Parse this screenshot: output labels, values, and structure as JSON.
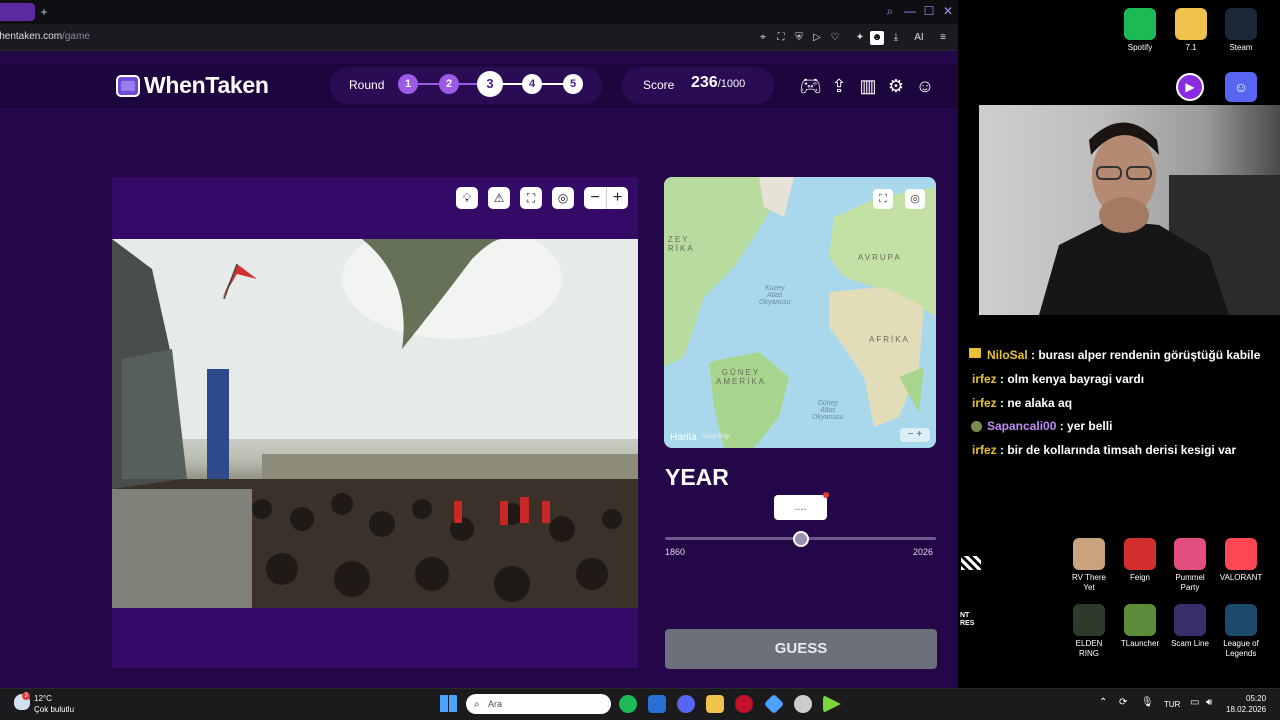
{
  "browser": {
    "url_host": "whentaken.com",
    "url_path": "/game",
    "new_tab_label": "+",
    "ai_label": "AI"
  },
  "header": {
    "logo": "WhenTaken",
    "round_label": "Round",
    "rounds": [
      "1",
      "2",
      "3",
      "4",
      "5"
    ],
    "current_round": 3,
    "score_label": "Score",
    "score": "236",
    "score_max": "/1000"
  },
  "map": {
    "labels": {
      "america_n": "ZEY\nRİKA",
      "europe": "AVRUPA",
      "africa": "AFRİKA",
      "south_america": "GÜNEY\nAMERİKA",
      "north_atlantic": "Kuzey\nAtlas\nOkyanusu",
      "south_atlantic": "Güney\nAtlas\nOkyanusu"
    },
    "brand": "Harita",
    "legal": "Yasal Bilgi"
  },
  "year": {
    "label": "YEAR",
    "value": "....",
    "min": "1860",
    "max": "2026",
    "slider_fraction": 0.5
  },
  "guess_label": "GUESS",
  "desktop_top": [
    {
      "name": "Spotify",
      "color": "#1db954"
    },
    {
      "name": "7.1",
      "color": "#f0c14b"
    },
    {
      "name": "Steam",
      "color": "#1b2838"
    }
  ],
  "chat": [
    {
      "user": "NiloSal",
      "text": " : burası alper rendenin görüştüğü kabile",
      "style": "u2"
    },
    {
      "user": "irfez",
      "text": " : olm kenya bayragi vardı",
      "style": "u"
    },
    {
      "user": "irfez",
      "text": " : ne alaka aq",
      "style": "u"
    },
    {
      "user": "Sapancali00",
      "text": " : yer belli",
      "style": "u2"
    },
    {
      "user": "irfez",
      "text": " : bir de kollarında timsah derisi kesigi var",
      "style": "u"
    }
  ],
  "desktop_bottom": [
    {
      "name": "RV There Yet",
      "color": "#c9a27e"
    },
    {
      "name": "Feign",
      "color": "#d32f2f"
    },
    {
      "name": "Pummel Party",
      "color": "#e24f7e"
    },
    {
      "name": "VALORANT",
      "color": "#ff4655"
    },
    {
      "name": "ELDEN RING",
      "color": "#2f3b2a"
    },
    {
      "name": "TLauncher",
      "color": "#5b8c3a"
    },
    {
      "name": "Scam Line",
      "color": "#3a2f6a"
    },
    {
      "name": "League of Legends",
      "color": "#1b4a6a"
    }
  ],
  "side_text": "NT\nRES",
  "taskbar": {
    "temperature": "12°C",
    "weather": "Çok bulutlu",
    "weather_badge": "3",
    "search_placeholder": "Ara",
    "lang": "TUR",
    "time": "05:20",
    "date": "18.02.2026"
  }
}
